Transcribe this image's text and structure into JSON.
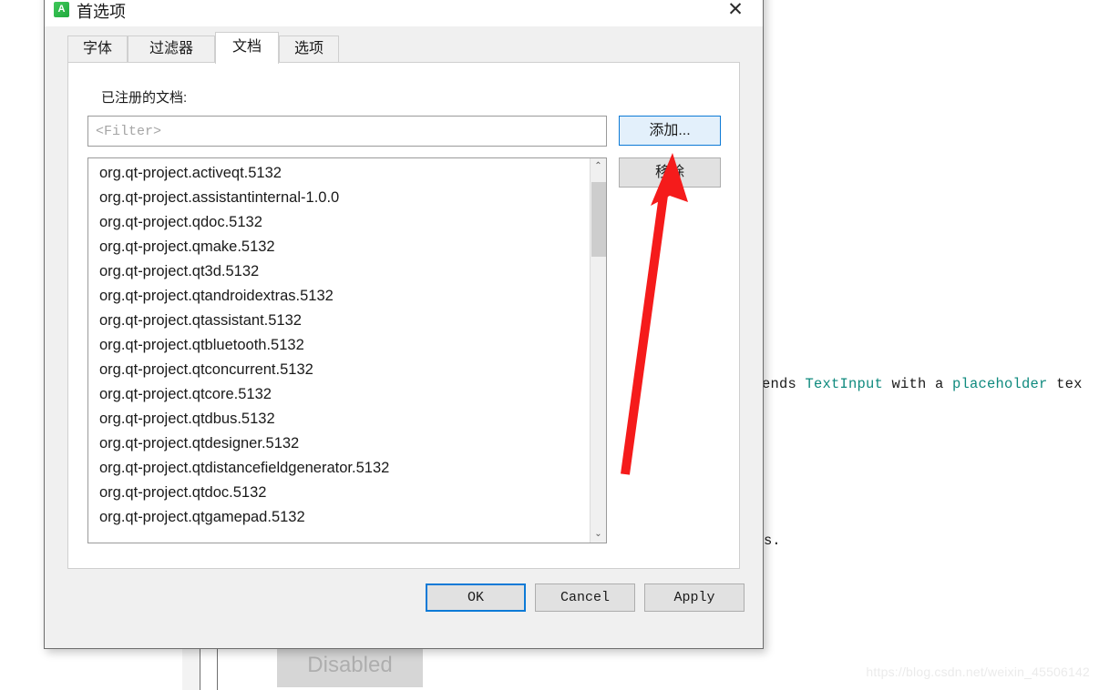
{
  "window": {
    "title": "首选项",
    "app_icon": "A",
    "close_icon": "✕"
  },
  "tabs": [
    {
      "label": "字体",
      "active": false
    },
    {
      "label": "过滤器",
      "active": false
    },
    {
      "label": "文档",
      "active": true
    },
    {
      "label": "选项",
      "active": false
    }
  ],
  "documents_tab": {
    "group_label": "已注册的文档:",
    "filter": {
      "value": "",
      "placeholder": "<Filter>"
    },
    "add_button": "添加...",
    "remove_button": "移除",
    "registered_documents": [
      "org.qt-project.activeqt.5132",
      "org.qt-project.assistantinternal-1.0.0",
      "org.qt-project.qdoc.5132",
      "org.qt-project.qmake.5132",
      "org.qt-project.qt3d.5132",
      "org.qt-project.qtandroidextras.5132",
      "org.qt-project.qtassistant.5132",
      "org.qt-project.qtbluetooth.5132",
      "org.qt-project.qtconcurrent.5132",
      "org.qt-project.qtcore.5132",
      "org.qt-project.qtdbus.5132",
      "org.qt-project.qtdesigner.5132",
      "org.qt-project.qtdistancefieldgenerator.5132",
      "org.qt-project.qtdoc.5132",
      "org.qt-project.qtgamepad.5132"
    ],
    "scrollbar": {
      "up_arrow": "⌃",
      "down_arrow": "⌄"
    }
  },
  "footer": {
    "ok": "OK",
    "cancel": "Cancel",
    "apply": "Apply"
  },
  "background": {
    "code_prefix": "ends ",
    "code_kw1": "TextInput",
    "code_mid": " with a ",
    "code_kw2": "placeholder",
    "code_suffix": " tex",
    "text_2": "s.",
    "disabled_button": "Disabled",
    "watermark": "https://blog.csdn.net/weixin_45506142"
  },
  "annotation": {
    "arrow_color": "#f51b1b"
  },
  "colors": {
    "accent": "#0d7ad6",
    "dialog_bg": "#f0f0f0",
    "panel_bg": "#ffffff",
    "button_bg": "#e1e1e1",
    "code_keyword": "#0f8a7e"
  }
}
